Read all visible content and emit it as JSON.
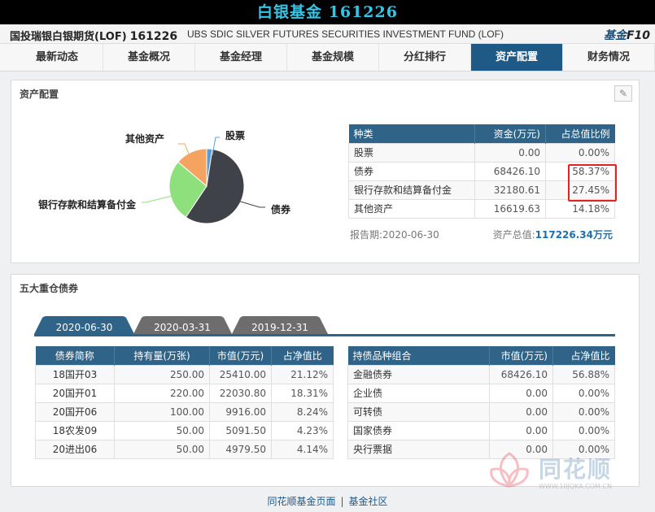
{
  "header": {
    "title": "白银基金 161226"
  },
  "fund": {
    "name": "国投瑞银白银期货(LOF)",
    "code": "161226",
    "english_name": "UBS SDIC SILVER FUTURES SECURITIES INVESTMENT FUND (LOF)",
    "logo": {
      "a": "基金",
      "b": "F10"
    }
  },
  "nav": {
    "tabs": [
      {
        "label": "最新动态"
      },
      {
        "label": "基金概况"
      },
      {
        "label": "基金经理"
      },
      {
        "label": "基金规模"
      },
      {
        "label": "分红排行"
      },
      {
        "label": "资产配置",
        "active": true
      },
      {
        "label": "财务情况"
      }
    ]
  },
  "allocation": {
    "title": "资产配置",
    "pie_labels": {
      "stock": "股票",
      "other": "其他资产",
      "bank": "银行存款和结算备付金",
      "bond": "债券"
    },
    "pie_colors": {
      "stock": "#5b9bd5",
      "bond": "#3f4248",
      "bank": "#8de07c",
      "other": "#f4a460"
    },
    "table": {
      "headers": [
        "种类",
        "资金(万元)",
        "占总值比例"
      ],
      "rows": [
        [
          "股票",
          "0.00",
          "0.00%"
        ],
        [
          "债券",
          "68426.10",
          "58.37%"
        ],
        [
          "银行存款和结算备付金",
          "32180.61",
          "27.45%"
        ],
        [
          "其他资产",
          "16619.63",
          "14.18%"
        ]
      ]
    },
    "report_date_label": "报告期:2020-06-30",
    "total_label": "资产总值:",
    "total_value": "117226.34万元"
  },
  "chart_data": {
    "type": "pie",
    "categories": [
      "股票",
      "债券",
      "银行存款和结算备付金",
      "其他资产"
    ],
    "values": [
      2.5,
      58.37,
      27.45,
      14.18
    ]
  },
  "top_bonds": {
    "title": "五大重仓债券",
    "date_tabs": [
      "2020-06-30",
      "2020-03-31",
      "2019-12-31"
    ],
    "bond_table": {
      "headers": [
        "债券简称",
        "持有量(万张)",
        "市值(万元)",
        "占净值比"
      ],
      "rows": [
        [
          "18国开03",
          "250.00",
          "25410.00",
          "21.12%"
        ],
        [
          "20国开01",
          "220.00",
          "22030.80",
          "18.31%"
        ],
        [
          "20国开06",
          "100.00",
          "9916.00",
          "8.24%"
        ],
        [
          "18农发09",
          "50.00",
          "5091.50",
          "4.23%"
        ],
        [
          "20进出06",
          "50.00",
          "4979.50",
          "4.14%"
        ]
      ]
    },
    "type_table": {
      "headers": [
        "持债品种组合",
        "市值(万元)",
        "占净值比"
      ],
      "rows": [
        [
          "金融债券",
          "68426.10",
          "56.88%"
        ],
        [
          "企业债",
          "0.00",
          "0.00%"
        ],
        [
          "可转债",
          "0.00",
          "0.00%"
        ],
        [
          "国家债券",
          "0.00",
          "0.00%"
        ],
        [
          "央行票据",
          "0.00",
          "0.00%"
        ]
      ]
    }
  },
  "footer": {
    "link1": "同花顺基金页面",
    "sep": "|",
    "link2": "基金社区"
  },
  "watermark": {
    "text": "同花顺",
    "url": "WWW.10JQKA.COM.CN"
  }
}
